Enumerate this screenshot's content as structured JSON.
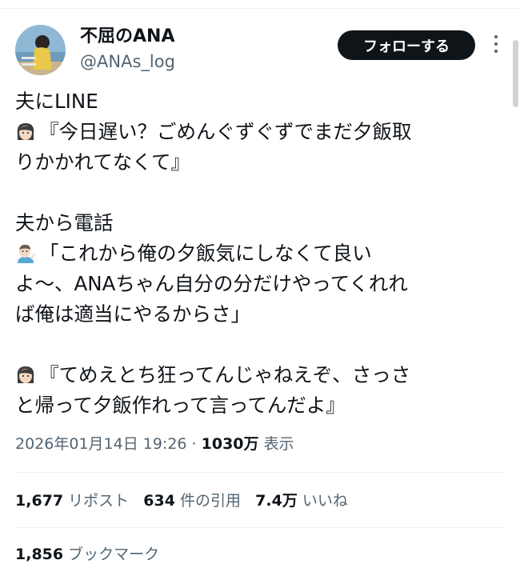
{
  "author": {
    "display_name": "不屈のANA",
    "handle": "@ANAs_log",
    "follow_label": "フォローする"
  },
  "tweet": {
    "line1": "夫にLINE",
    "line2": "『今日遅い？ごめんぐずぐずでまだ夕飯取",
    "line3": "りかかれてなくて』",
    "line4": "夫から電話",
    "line5": "「これから俺の夕飯気にしなくて良い",
    "line6": "よ〜、ANAちゃん自分の分だけやってくれれ",
    "line7": "ば俺は適当にやるからさ」",
    "line8": "『てめえとち狂ってんじゃねえぞ、さっさ",
    "line9": "と帰って夕飯作れって言ってんだよ』"
  },
  "meta": {
    "timestamp": "2026年01月14日 19:26",
    "separator": " · ",
    "views_count": "1030万",
    "views_label": " 表示"
  },
  "stats": {
    "reposts_count": "1,677",
    "reposts_label": "リポスト",
    "quotes_count": "634",
    "quotes_label": "件の引用",
    "likes_count": "7.4万",
    "likes_label": "いいね",
    "bookmarks_count": "1,856",
    "bookmarks_label": "ブックマーク"
  },
  "icons": [
    "avatar-photo",
    "more-options-icon",
    "woman-emoji",
    "man-tipping-hand-emoji"
  ]
}
